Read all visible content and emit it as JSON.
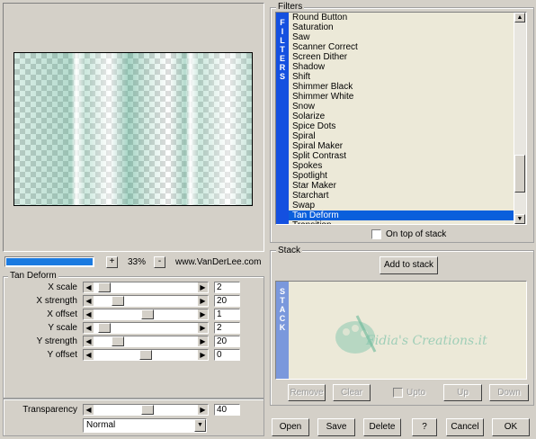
{
  "filters": {
    "label": "Filters",
    "band": [
      "F",
      "I",
      "L",
      "T",
      "E",
      "R",
      "S"
    ],
    "items": [
      "Round Button",
      "Saturation",
      "Saw",
      "Scanner Correct",
      "Screen Dither",
      "Shadow",
      "Shift",
      "Shimmer Black",
      "Shimmer White",
      "Snow",
      "Solarize",
      "Spice Dots",
      "Spiral",
      "Spiral Maker",
      "Split Contrast",
      "Spokes",
      "Spotlight",
      "Star Maker",
      "Starchart",
      "Swap",
      "Tan Deform",
      "Transition"
    ],
    "selected_index": 20,
    "on_top_label": "On top of stack"
  },
  "zoom": {
    "minus": "-",
    "plus": "+",
    "value": "33%",
    "progress": 1.0
  },
  "credit": "www.VanDerLee.com",
  "params": {
    "label": "Tan Deform",
    "rows": [
      {
        "label": "X scale",
        "value": "2",
        "level": 0.05
      },
      {
        "label": "X strength",
        "value": "20",
        "level": 0.2
      },
      {
        "label": "X offset",
        "value": "1",
        "level": 0.52
      },
      {
        "label": "Y scale",
        "value": "2",
        "level": 0.05
      },
      {
        "label": "Y strength",
        "value": "20",
        "level": 0.2
      },
      {
        "label": "Y offset",
        "value": "0",
        "level": 0.5
      }
    ]
  },
  "transparency": {
    "label": "Transparency",
    "value": "40",
    "level": 0.52
  },
  "blend": {
    "selected": "Normal"
  },
  "stack": {
    "label": "Stack",
    "add_label": "Add to stack",
    "band": [
      "S",
      "T",
      "A",
      "C",
      "K"
    ],
    "watermark": "Fidia's Creations.it",
    "remove": "Remove",
    "clear": "Clear",
    "upto": "Upto",
    "up": "Up",
    "down": "Down"
  },
  "buttons": {
    "open": "Open",
    "save": "Save",
    "delete": "Delete",
    "help": "?",
    "cancel": "Cancel",
    "ok": "OK"
  },
  "colors": {
    "selection": "#0a5fdc",
    "band": "#1450e0",
    "stack_band": "#7a98dc",
    "list_bg": "#ece9d8"
  }
}
